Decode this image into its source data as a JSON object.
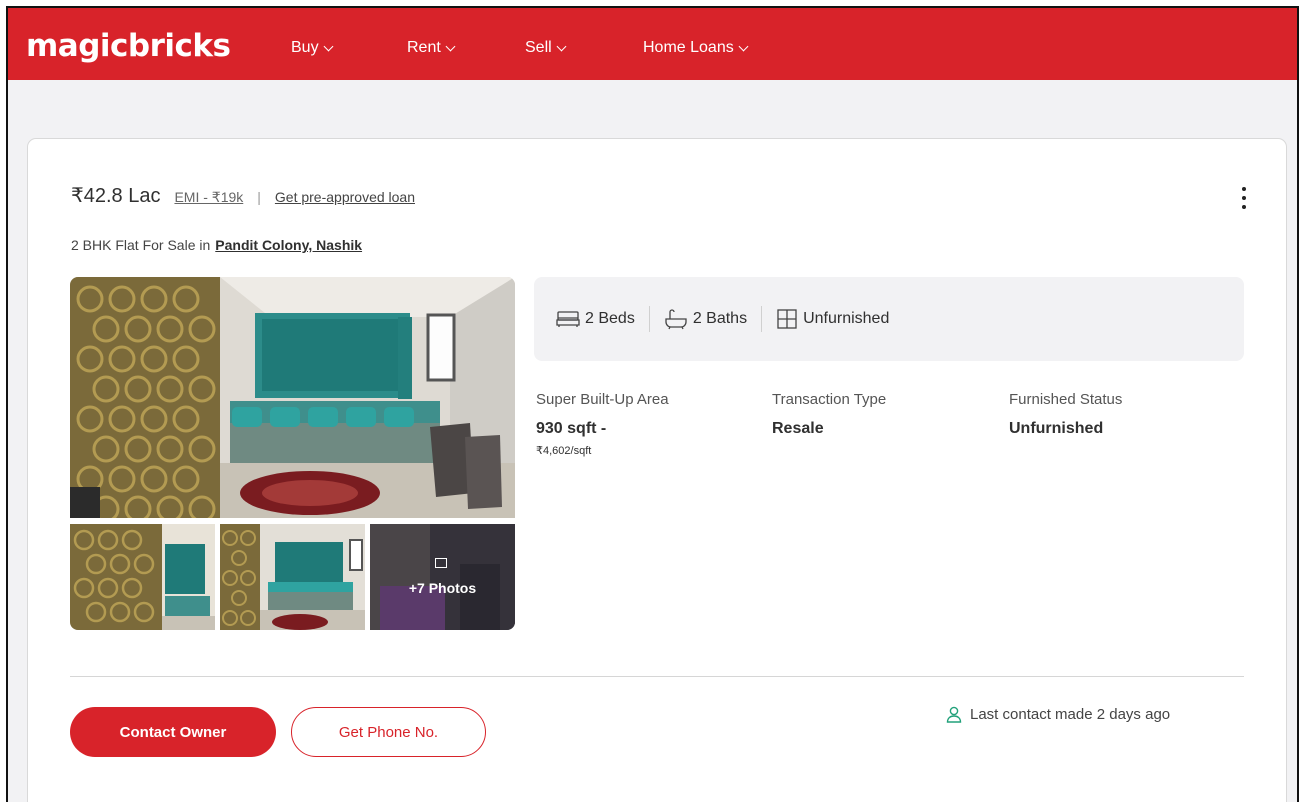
{
  "header": {
    "logo": "magicbricks",
    "nav": [
      {
        "label": "Buy"
      },
      {
        "label": "Rent"
      },
      {
        "label": "Sell"
      },
      {
        "label": "Home Loans"
      }
    ]
  },
  "listing": {
    "price": "₹42.8 Lac",
    "emi": "EMI - ₹19k",
    "separator": "|",
    "loan_link": "Get pre-approved loan",
    "subtitle_prefix": "2 BHK Flat For Sale in",
    "location": "Pandit Colony, Nashik",
    "more_photos": "+7 Photos",
    "amenities": [
      {
        "icon": "bed-icon",
        "label": "2 Beds"
      },
      {
        "icon": "bath-icon",
        "label": "2 Baths"
      },
      {
        "icon": "furnishing-icon",
        "label": "Unfurnished"
      }
    ],
    "summary": [
      {
        "label": "Super Built-Up Area",
        "value": "930 sqft -",
        "sub": "₹4,602/sqft"
      },
      {
        "label": "Transaction Type",
        "value": "Resale"
      },
      {
        "label": "Furnished Status",
        "value": "Unfurnished"
      }
    ],
    "contact_button": "Contact Owner",
    "phone_button": "Get Phone No.",
    "last_contact": "Last contact made 2 days ago"
  },
  "colors": {
    "brand_red": "#d8232a",
    "contact_icon_green": "#21a17a"
  }
}
